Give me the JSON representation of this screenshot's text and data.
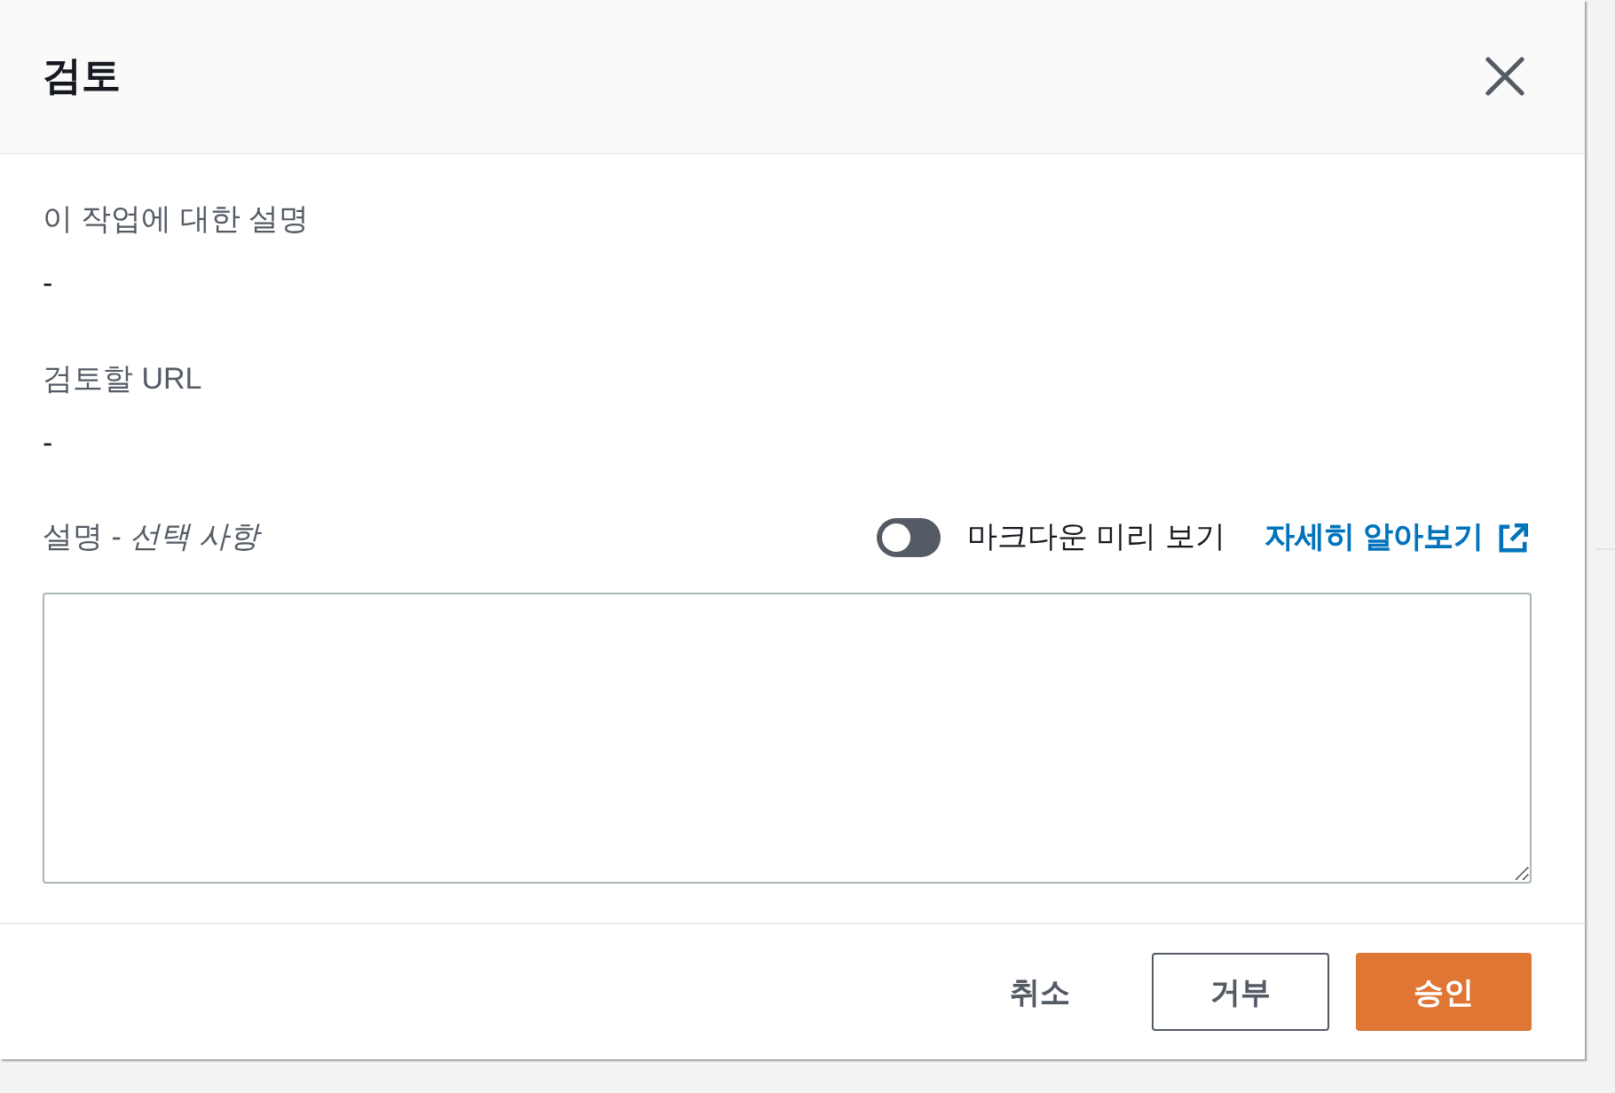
{
  "dialog": {
    "title": "검토"
  },
  "fields": [
    {
      "label": "이 작업에 대한 설명",
      "value": "-"
    },
    {
      "label": "검토할 URL",
      "value": "-"
    }
  ],
  "comment": {
    "label": "설명 - *선택 사항*",
    "toggle": {
      "label": "마크다운 미리 보기",
      "on": false
    },
    "link": "자세히 알아보기"
  },
  "buttons": [
    {
      "label": "취소",
      "kind": "link"
    },
    {
      "label": "거부",
      "kind": "normal"
    },
    {
      "label": "승인",
      "kind": "primary"
    }
  ]
}
